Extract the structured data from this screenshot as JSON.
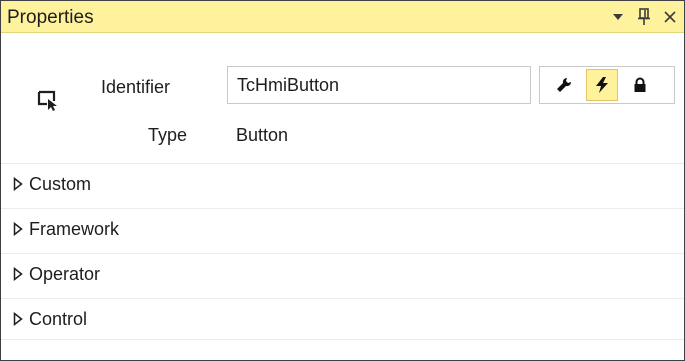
{
  "panel": {
    "title": "Properties"
  },
  "titlebar_icons": [
    "dropdown-arrow-icon",
    "pin-icon",
    "close-icon"
  ],
  "header": {
    "identifier_label": "Identifier",
    "identifier_value": "TcHmiButton",
    "type_label": "Type",
    "type_value": "Button",
    "control_icon": "control-select-icon"
  },
  "view_buttons": [
    {
      "icon": "wrench-icon",
      "active": false
    },
    {
      "icon": "lightning-icon",
      "active": true
    },
    {
      "icon": "lock-icon",
      "active": false
    }
  ],
  "sections": [
    {
      "label": "Custom",
      "expanded": false
    },
    {
      "label": "Framework",
      "expanded": false
    },
    {
      "label": "Operator",
      "expanded": false
    },
    {
      "label": "Control",
      "expanded": false
    }
  ],
  "colors": {
    "titlebar": "#fff29d",
    "active_button": "#fff29d",
    "border": "#c9c9c9"
  }
}
